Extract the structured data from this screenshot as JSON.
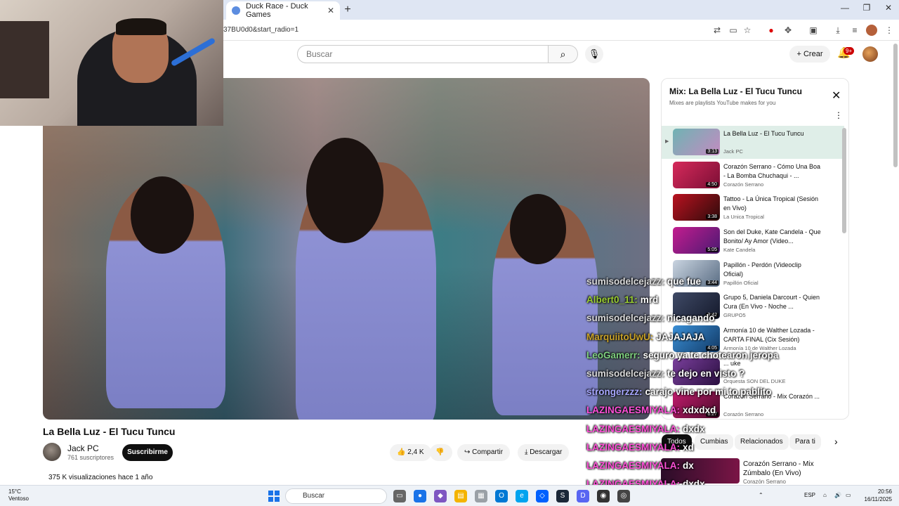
{
  "browser": {
    "tab_title": "Duck Race - Duck Games",
    "url": "37BU0d0&start_radio=1"
  },
  "youtube": {
    "search_placeholder": "Buscar",
    "create_label": "Crear",
    "notif_badge": "9+"
  },
  "video": {
    "title": "La Bella Luz - El Tucu Tuncu",
    "channel": "Jack PC",
    "subscribers": "761 suscriptores",
    "subscribe_label": "Suscribirme",
    "likes": "2,4 K",
    "share_label": "Compartir",
    "download_label": "Descargar",
    "stats": "375 K visualizaciones  hace 1 año"
  },
  "playlist": {
    "title": "Mix: La Bella Luz - El Tucu Tuncu",
    "subtitle": "Mixes are playlists YouTube makes for you",
    "items": [
      {
        "title": "La Bella Luz - El Tucu Tuncu",
        "channel": "Jack PC",
        "duration": "3:13"
      },
      {
        "title": "Corazón Serrano - Cómo Una Boa - La Bomba Chuchaqui - ...",
        "channel": "Corazón Serrano",
        "duration": "4:50"
      },
      {
        "title": "Tattoo - La Única Tropical (Sesión en Vivo)",
        "channel": "La Unica Tropical",
        "duration": "3:38"
      },
      {
        "title": "Son del Duke, Kate Candela - Que Bonito/ Ay Amor (Video...",
        "channel": "Kate Candela",
        "duration": "5:05"
      },
      {
        "title": "Papillón - Perdón (Videoclip Oficial)",
        "channel": "Papillón Oficial",
        "duration": "3:44"
      },
      {
        "title": "Grupo 5, Daniela Darcourt - Quien Cura (En Vivo - Noche ...",
        "channel": "GRUPO5",
        "duration": "3:42"
      },
      {
        "title": "Armonía 10 de Walther Lozada - CARTA FINAL (Cix Sesión)",
        "channel": "Armonía 10 de Walther Lozada",
        "duration": "4:05"
      },
      {
        "title": "... uke",
        "channel": "Orquesta SON DEL DUKE",
        "duration": ""
      },
      {
        "title": "Corazón Serrano - Mix Corazón ...",
        "channel": "Corazón Serrano",
        "duration": "6:27"
      }
    ]
  },
  "chips": [
    "Todos",
    "Cumbias",
    "Relacionados",
    "Para ti"
  ],
  "next_video": {
    "title": "Corazón Serrano - Mix Zúmbalo (En Vivo)",
    "channel": "Corazón Serrano"
  },
  "chat": [
    {
      "user": "sumisodelcejazz:",
      "msg": "que fue",
      "color": "#d9d9d9"
    },
    {
      "user": "Albert0_11:",
      "msg": "mrd",
      "color": "#9acd32"
    },
    {
      "user": "sumisodelcejazz:",
      "msg": "nicagando",
      "color": "#d9d9d9"
    },
    {
      "user": "MarquiitoUwU:",
      "msg": "JAJAJAJA",
      "color": "#c9a227"
    },
    {
      "user": "LeoGamerr:",
      "msg": "seguro ya te chotearon jeropa",
      "color": "#7fd17f"
    },
    {
      "user": "sumisodelcejazz:",
      "msg": "te dejo en visto ?",
      "color": "#d9d9d9"
    },
    {
      "user": "strongerzzz:",
      "msg": "carajo vine por mi to pablito",
      "color": "#a7a7ff"
    },
    {
      "user": "LAZINGAESMIYALA:",
      "msg": "xdxdxd",
      "color": "#ff4fd8"
    },
    {
      "user": "LAZINGAESMIYALA:",
      "msg": "dxdx",
      "color": "#ff4fd8"
    },
    {
      "user": "LAZINGAESMIYALA:",
      "msg": "xd",
      "color": "#ff4fd8"
    },
    {
      "user": "LAZINGAESMIYALA:",
      "msg": "dx",
      "color": "#ff4fd8"
    },
    {
      "user": "LAZINGAESMIYALA:",
      "msg": "dxdx",
      "color": "#ff4fd8"
    }
  ],
  "taskbar": {
    "temp": "15°C",
    "weather": "Ventoso",
    "search": "Buscar",
    "lang": "ESP",
    "time": "20:56",
    "date": "16/11/2025"
  }
}
